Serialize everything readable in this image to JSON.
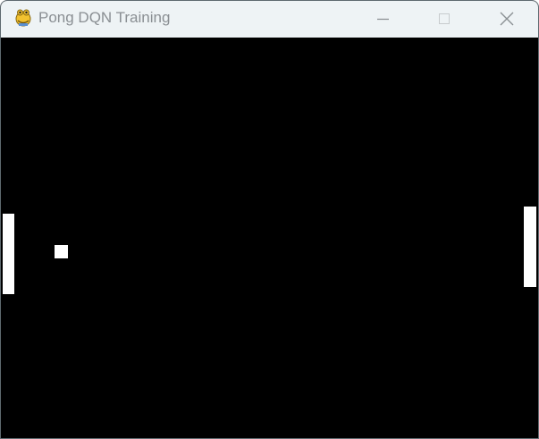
{
  "window": {
    "title": "Pong DQN Training",
    "app_icon": "pygame-snake-icon",
    "controls": {
      "minimize_icon": "minimize-icon",
      "maximize_icon": "maximize-icon",
      "close_icon": "close-icon"
    }
  },
  "game": {
    "background_color": "#000000",
    "paddle_color": "#ffffff",
    "ball_color": "#ffffff"
  }
}
